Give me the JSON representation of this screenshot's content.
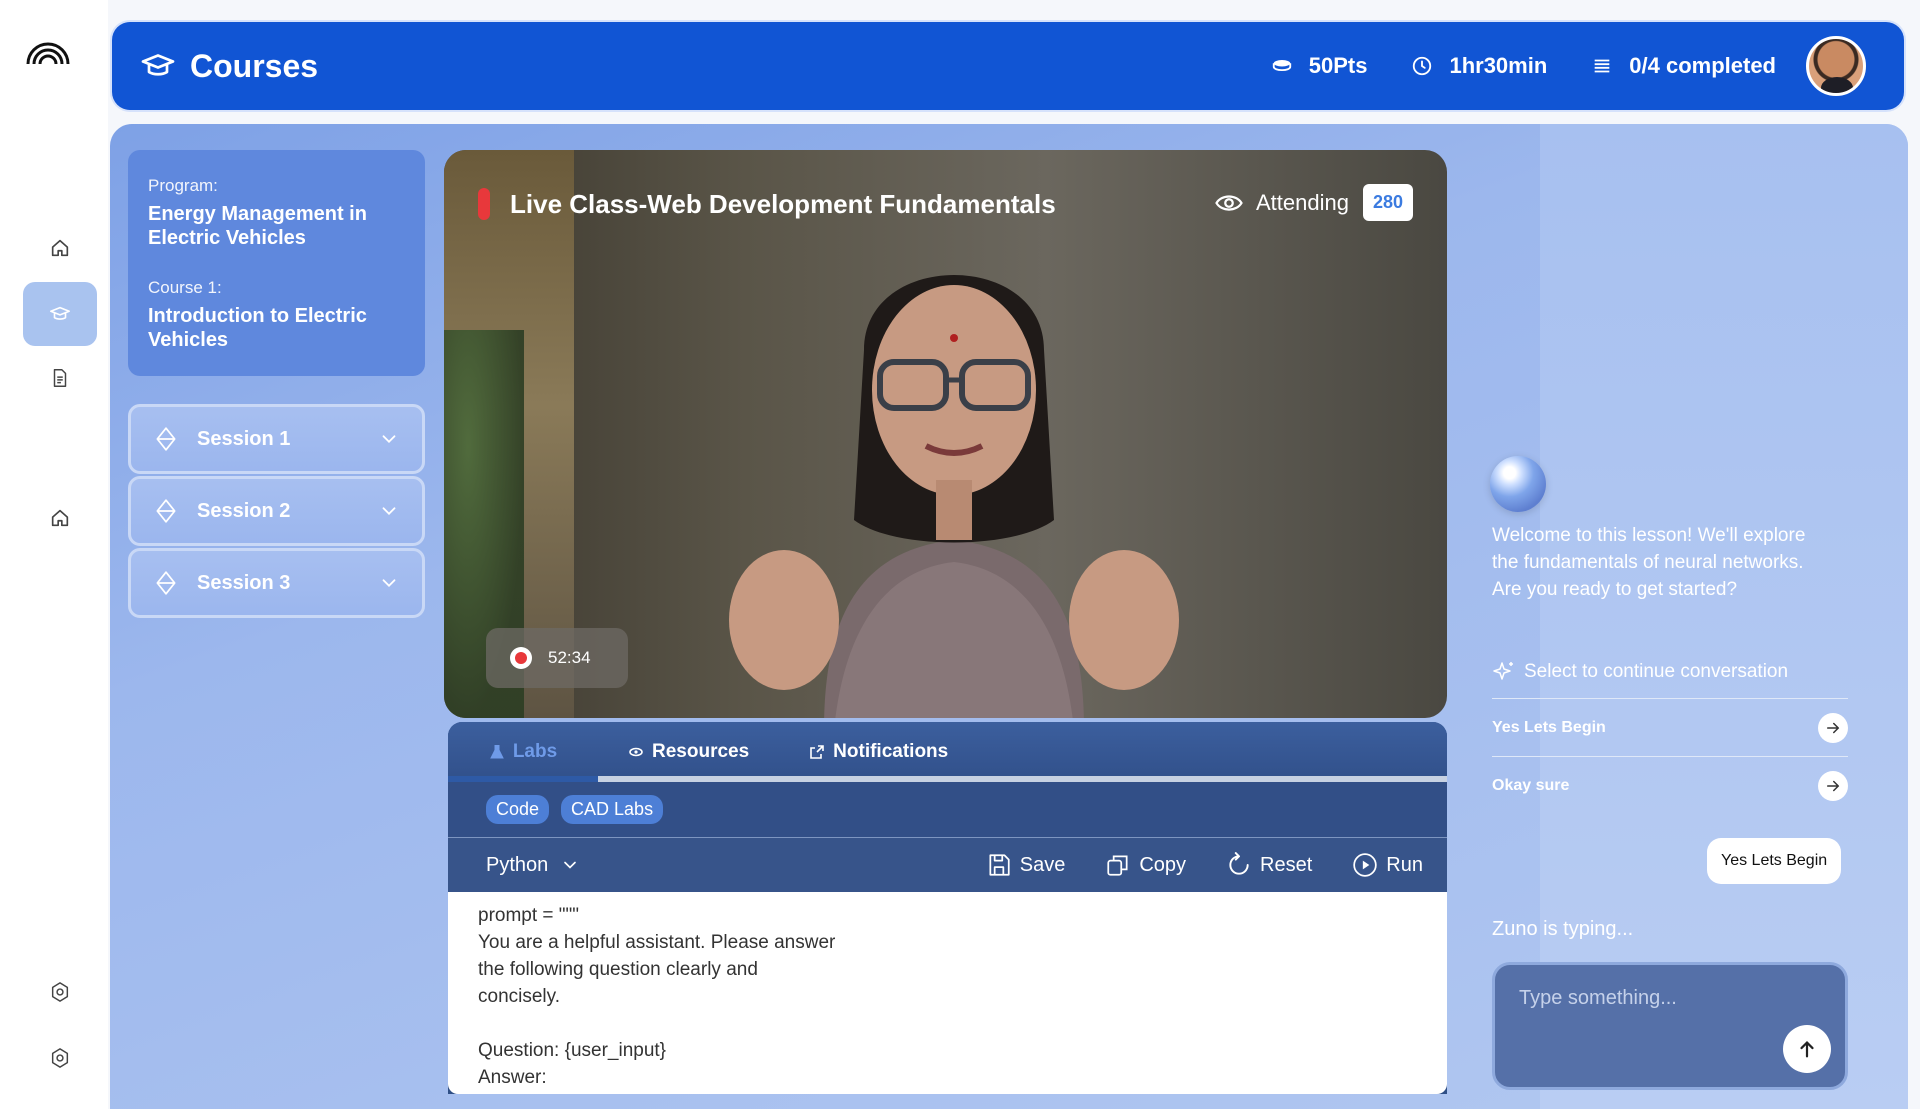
{
  "header": {
    "title": "Courses",
    "points": "50Pts",
    "duration": "1hr30min",
    "progress": "0/4 completed"
  },
  "sidebar": {
    "program_label": "Program:",
    "program_value": "Energy Management in Electric  Vehicles",
    "course_label": "Course 1:",
    "course_value": "Introduction to Electric Vehicles",
    "sessions": [
      {
        "label": "Session 1"
      },
      {
        "label": "Session 2"
      },
      {
        "label": "Session 3"
      }
    ]
  },
  "video": {
    "title": "Live Class-Web Development Fundamentals",
    "attending_label": "Attending",
    "attending_count": "280",
    "elapsed": "52:34"
  },
  "labs": {
    "tabs": [
      {
        "label": "Labs"
      },
      {
        "label": "Resources"
      },
      {
        "label": "Notifications"
      }
    ],
    "chips": [
      "Code",
      "CAD Labs"
    ],
    "language": "Python",
    "actions": {
      "save": "Save",
      "copy": "Copy",
      "reset": "Reset",
      "run": "Run"
    },
    "code": "prompt = \"\"\"\nYou are a helpful assistant. Please answer\nthe following question clearly and\nconcisely.\n\nQuestion: {user_input}\nAnswer:"
  },
  "chat": {
    "welcome": "Welcome to this lesson! We'll explore the fundamentals of neural networks. Are you ready to get started?",
    "select_prompt": "Select to continue conversation",
    "options": [
      {
        "label": "Yes Lets Begin"
      },
      {
        "label": "Okay sure"
      }
    ],
    "user_reply": "Yes Lets Begin",
    "typing": "Zuno is typing...",
    "input_placeholder": "Type something..."
  },
  "colors": {
    "header_blue": "#1155d4",
    "record_red": "#e8383b",
    "accent_blue": "#3b7be0"
  }
}
